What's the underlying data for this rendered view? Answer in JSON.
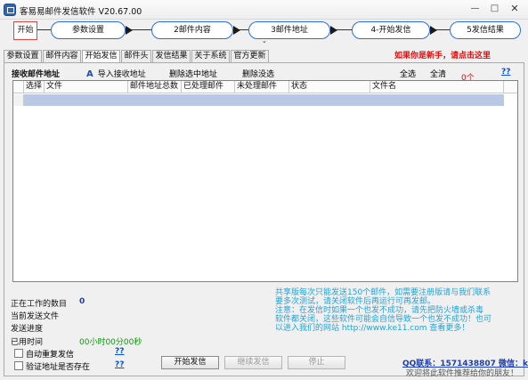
{
  "window": {
    "title": "客易易邮件发信软件 V20.67.00",
    "min_label": "—",
    "max_label": "□",
    "close_label": "✕"
  },
  "flow": {
    "start_label": "开始",
    "steps": [
      {
        "label": "参数设置"
      },
      {
        "label": "2邮件内容"
      },
      {
        "label": "3邮件地址"
      },
      {
        "label": "4-开始发信"
      },
      {
        "label": "5发信结果"
      }
    ],
    "chevron": "⌄"
  },
  "tabs": [
    {
      "label": "参数设置"
    },
    {
      "label": "邮件内容"
    },
    {
      "label": "开始发信"
    },
    {
      "label": "邮件头"
    },
    {
      "label": "发信结果"
    },
    {
      "label": "关于系统"
    },
    {
      "label": "官方更新"
    }
  ],
  "help_link": "如果你是新手，请点击这里",
  "toolbar": {
    "recv_label": "接收邮件地址",
    "import_icon": "A",
    "import_label": "导入接收地址",
    "delete_selected": "删除选中地址",
    "delete_unselected": "删除没选",
    "select_all": "全选",
    "clear_all": "全清",
    "count": "0个",
    "qq": "??"
  },
  "grid": {
    "columns": [
      "选择",
      "文件",
      "邮件地址总数",
      "已处理邮件",
      "未处理邮件",
      "状态",
      "文件名"
    ]
  },
  "status": {
    "active_jobs_label": "正在工作的数目",
    "active_jobs_value": "0",
    "current_file_label": "当前发送文件",
    "progress_label": "发送进度",
    "elapsed_label": "已用时间",
    "elapsed_value": "00小时00分00秒",
    "auto_resend_label": "自动重复发信",
    "verify_label": "验证地址是否存在",
    "qq_a": "??",
    "qq_b": "??"
  },
  "buttons": {
    "start": "开始发信",
    "continue": "继续发信",
    "stop": "停止"
  },
  "notice": "共享版每次只能发送150个邮件，如需要注册版请与我们联系\n要多次测试，请关闭软件后再运行可再发邮。\n      注意：在发信时如果一个也发不成功，请先把防火墙或杀毒\n软件都关闭，这些软件可能会自信导致一个也发不成功！也可\n以进入我们的网站 http://www.ke11.com 查看更多！",
  "contact": "QQ联系：1571438807  微信：k",
  "welcome": "欢迎将此软件推荐给你的朋友！",
  "colors": {
    "step_border": "#2a6edc",
    "start_border": "#e14343",
    "notice": "#26a2d6",
    "selection_row": "#b9c9e5",
    "link_red": "#e01010",
    "link_blue": "#0050e0"
  }
}
